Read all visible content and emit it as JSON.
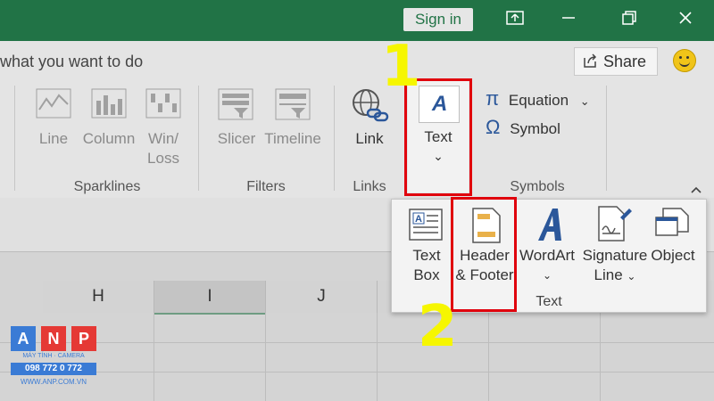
{
  "titlebar": {
    "sign_in": "Sign in"
  },
  "ribbon": {
    "tell_me": "what you want to do",
    "share": "Share",
    "sparklines": {
      "group": "Sparklines",
      "line": "Line",
      "column": "Column",
      "winloss_1": "Win/",
      "winloss_2": "Loss"
    },
    "filters": {
      "group": "Filters",
      "slicer": "Slicer",
      "timeline": "Timeline"
    },
    "links": {
      "group": "Links",
      "link": "Link"
    },
    "text": {
      "label": "Text",
      "caret": "⌄"
    },
    "symbols": {
      "group": "Symbols",
      "equation": "Equation",
      "symbol": "Symbol"
    }
  },
  "text_popup": {
    "group": "Text",
    "text_box_1": "Text",
    "text_box_2": "Box",
    "header_footer_1": "Header",
    "header_footer_2": "& Footer",
    "wordart": "WordArt",
    "signature_1": "Signature",
    "signature_2": "Line",
    "object": "Object"
  },
  "callouts": {
    "step1": "1",
    "step2": "2"
  },
  "sheet": {
    "columns": [
      "H",
      "I",
      "J"
    ]
  },
  "watermark": {
    "letters": [
      "A",
      "N",
      "P"
    ],
    "line1": "MÁY TÍNH · CAMERA",
    "line2": "098 772 0 772",
    "line3": "WWW.ANP.COM.VN"
  },
  "colors": {
    "excel_green": "#217346",
    "highlight_red": "#e0000c",
    "callout_yellow": "#f6f600"
  }
}
